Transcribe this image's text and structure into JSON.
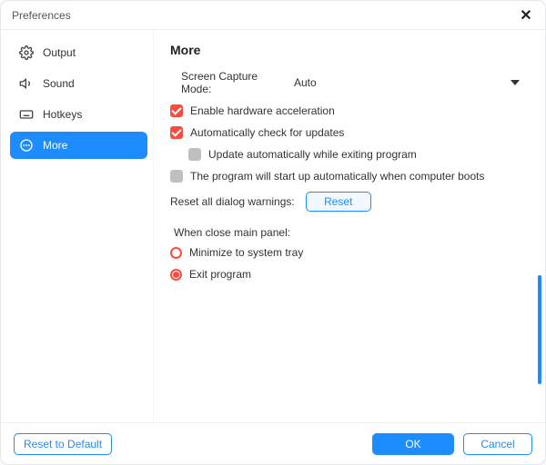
{
  "window": {
    "title": "Preferences"
  },
  "sidebar": {
    "items": [
      {
        "label": "Output"
      },
      {
        "label": "Sound"
      },
      {
        "label": "Hotkeys"
      },
      {
        "label": "More"
      }
    ]
  },
  "main": {
    "heading": "More",
    "capture_mode_label": "Screen Capture Mode:",
    "capture_mode_value": "Auto",
    "enable_hw_accel": "Enable hardware acceleration",
    "auto_check_updates": "Automatically check for updates",
    "update_on_exit": "Update automatically while exiting program",
    "autostart": "The program will start up automatically when computer boots",
    "reset_label": "Reset all dialog warnings:",
    "reset_btn": "Reset",
    "close_panel_label": "When close main panel:",
    "opt_minimize": "Minimize to system tray",
    "opt_exit": "Exit program"
  },
  "footer": {
    "reset_default": "Reset to Default",
    "ok": "OK",
    "cancel": "Cancel"
  }
}
